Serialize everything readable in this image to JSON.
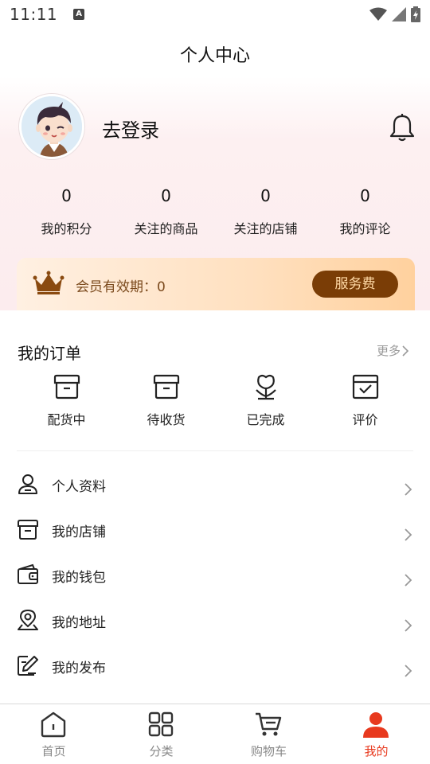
{
  "status_bar": {
    "time": "11:11",
    "notification_icon": "A"
  },
  "header": {
    "title": "个人中心"
  },
  "profile": {
    "login_text": "去登录"
  },
  "stats": [
    {
      "value": "0",
      "label": "我的积分"
    },
    {
      "value": "0",
      "label": "关注的商品"
    },
    {
      "value": "0",
      "label": "关注的店铺"
    },
    {
      "value": "0",
      "label": "我的评论"
    }
  ],
  "membership": {
    "text": "会员有效期：0",
    "button": "服务费"
  },
  "orders": {
    "title": "我的订单",
    "more": "更多",
    "items": [
      {
        "label": "配货中",
        "icon": "box-icon"
      },
      {
        "label": "待收货",
        "icon": "box-icon"
      },
      {
        "label": "已完成",
        "icon": "flower-icon"
      },
      {
        "label": "评价",
        "icon": "check-box-icon"
      }
    ]
  },
  "menu": [
    {
      "label": "个人资料",
      "icon": "user-icon"
    },
    {
      "label": "我的店铺",
      "icon": "store-icon"
    },
    {
      "label": "我的钱包",
      "icon": "wallet-icon"
    },
    {
      "label": "我的地址",
      "icon": "location-icon"
    },
    {
      "label": "我的发布",
      "icon": "edit-icon"
    }
  ],
  "tabs": [
    {
      "label": "首页",
      "icon": "home-icon"
    },
    {
      "label": "分类",
      "icon": "grid-icon"
    },
    {
      "label": "购物车",
      "icon": "cart-icon"
    },
    {
      "label": "我的",
      "icon": "person-icon"
    }
  ],
  "colors": {
    "accent": "#e8391e",
    "gold_dark": "#7a3d06",
    "gold_light": "#ffd9a6"
  }
}
